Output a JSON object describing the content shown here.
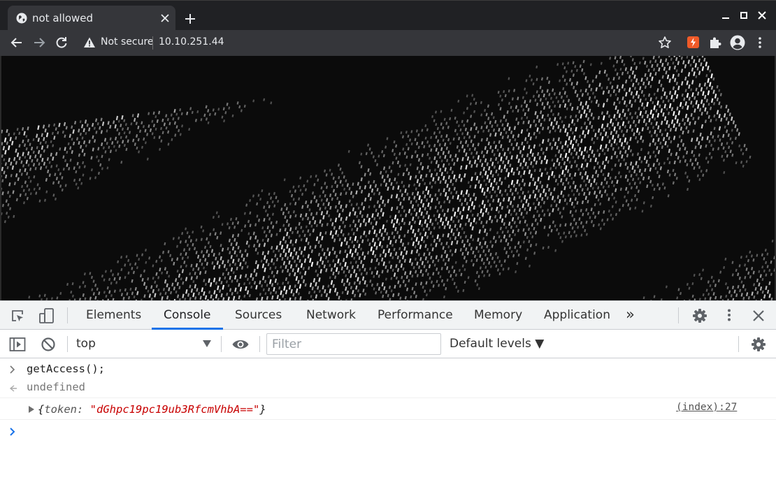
{
  "browser": {
    "tab": {
      "title": "not allowed"
    },
    "omnibox": {
      "security_label": "Not secure",
      "url": "10.10.251.44"
    },
    "icons": {
      "favicon": "globe-icon",
      "close": "close-icon",
      "new_tab": "plus-icon",
      "back": "arrow-left-icon",
      "forward": "arrow-right-icon",
      "reload": "reload-icon",
      "warning": "warning-icon",
      "bookmark": "star-icon",
      "extension": "puzzle-icon",
      "profile": "avatar-icon",
      "menu": "kebab-icon"
    }
  },
  "devtools": {
    "tabs": [
      {
        "label": "Elements"
      },
      {
        "label": "Console",
        "active": true
      },
      {
        "label": "Sources"
      },
      {
        "label": "Network"
      },
      {
        "label": "Performance"
      },
      {
        "label": "Memory"
      },
      {
        "label": "Application"
      }
    ],
    "more_tabs": "»",
    "console": {
      "context": "top",
      "filter_placeholder": "Filter",
      "levels": "Default levels ▼"
    },
    "messages": {
      "input": "getAccess();",
      "result": "undefined",
      "log": {
        "open_brace": "{",
        "key": "token: ",
        "value": "\"dGhpc19pc19ub3RfcmVhbA==\"",
        "close_brace": "}",
        "source": "(index):27"
      }
    },
    "colors": {
      "accent": "#1a73e8",
      "string": "#c80000"
    }
  }
}
